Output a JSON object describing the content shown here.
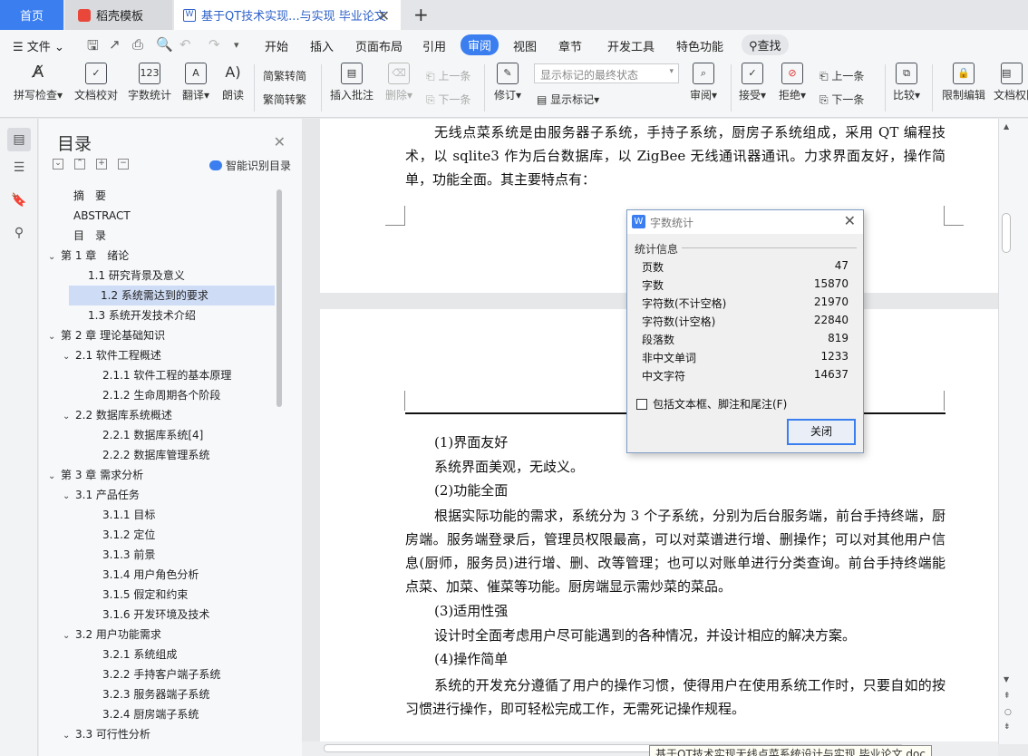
{
  "tabs": {
    "home": "首页",
    "templates": "稻壳模板",
    "document": "基于QT技术实现...与实现 毕业论文"
  },
  "menu": {
    "file": "文件",
    "start": "开始",
    "insert": "插入",
    "layout": "页面布局",
    "reference": "引用",
    "review": "审阅",
    "view": "视图",
    "chapter": "章节",
    "devtools": "开发工具",
    "features": "特色功能",
    "search": "查找"
  },
  "toolbar": {
    "spell": "拼写检查",
    "proofread": "文档校对",
    "wordcount": "字数统计",
    "translate": "翻译",
    "read": "朗读",
    "t2s": "繁转简",
    "s2t": "简转繁",
    "comment": "插入批注",
    "delete": "删除",
    "prev_comment": "上一条",
    "next_comment": "下一条",
    "track": "修订",
    "markstate": "显示标记的最终状态",
    "showmark": "显示标记",
    "reviewpane": "审阅",
    "accept": "接受",
    "reject": "拒绝",
    "prev_change": "上一条",
    "next_change": "下一条",
    "compare": "比较",
    "restrict": "限制编辑",
    "permission": "文档权限"
  },
  "outline": {
    "title": "目录",
    "smart": "智能识别目录",
    "items": [
      {
        "text": "摘　要",
        "level": 0,
        "caret": ""
      },
      {
        "text": "ABSTRACT",
        "level": 0,
        "caret": ""
      },
      {
        "text": "目　录",
        "level": 0,
        "caret": ""
      },
      {
        "text": "第 1 章　绪论",
        "level": 0,
        "caret": "down"
      },
      {
        "text": "1.1 研究背景及意义",
        "level": 1,
        "caret": ""
      },
      {
        "text": "1.2 系统需达到的要求",
        "level": 1,
        "caret": "",
        "selected": true
      },
      {
        "text": "1.3 系统开发技术介绍",
        "level": 1,
        "caret": ""
      },
      {
        "text": "第 2 章  理论基础知识",
        "level": 0,
        "caret": "down"
      },
      {
        "text": "2.1 软件工程概述",
        "level": 1,
        "caret": "down"
      },
      {
        "text": "2.1.1  软件工程的基本原理",
        "level": 2,
        "caret": ""
      },
      {
        "text": "2.1.2  生命周期各个阶段",
        "level": 2,
        "caret": ""
      },
      {
        "text": "2.2  数据库系统概述",
        "level": 1,
        "caret": "down"
      },
      {
        "text": "2.2.1  数据库系统[4]",
        "level": 2,
        "caret": ""
      },
      {
        "text": "2.2.2  数据库管理系统",
        "level": 2,
        "caret": ""
      },
      {
        "text": "第 3 章  需求分析",
        "level": 0,
        "caret": "down"
      },
      {
        "text": "3.1 产品任务",
        "level": 1,
        "caret": "down"
      },
      {
        "text": "3.1.1 目标",
        "level": 2,
        "caret": ""
      },
      {
        "text": "3.1.2 定位",
        "level": 2,
        "caret": ""
      },
      {
        "text": "3.1.3 前景",
        "level": 2,
        "caret": ""
      },
      {
        "text": "3.1.4 用户角色分析",
        "level": 2,
        "caret": ""
      },
      {
        "text": "3.1.5 假定和约束",
        "level": 2,
        "caret": ""
      },
      {
        "text": "3.1.6 开发环境及技术",
        "level": 2,
        "caret": ""
      },
      {
        "text": "3.2 用户功能需求",
        "level": 1,
        "caret": "down"
      },
      {
        "text": "3.2.1 系统组成",
        "level": 2,
        "caret": ""
      },
      {
        "text": "3.2.2 手持客户端子系统",
        "level": 2,
        "caret": ""
      },
      {
        "text": "3.2.3 服务器端子系统",
        "level": 2,
        "caret": ""
      },
      {
        "text": "3.2.4 厨房端子系统",
        "level": 2,
        "caret": ""
      },
      {
        "text": "3.3 可行性分析",
        "level": 1,
        "caret": "down"
      }
    ]
  },
  "doc": {
    "intro": "无线点菜系统是由服务器子系统，手持子系统，厨房子系统组成，采用 QT 编程技术，以 sqlite3 作为后台数据库，以 ZigBee 无线通讯器通讯。力求界面友好，操作简单，功能全面。其主要特点有：",
    "f1h": "(1)界面友好",
    "f1t": "系统界面美观，无歧义。",
    "f2h": "(2)功能全面",
    "f2t": "根据实际功能的需求，系统分为 3 个子系统，分别为后台服务端，前台手持终端，厨房端。服务端登录后，管理员权限最高，可以对菜谱进行增、删操作；可以对其他用户信息(厨师，服务员)进行增、删、改等管理；也可以对账单进行分类查询。前台手持终端能点菜、加菜、催菜等功能。厨房端显示需炒菜的菜品。",
    "f3h": "(3)适用性强",
    "f3t": "设计时全面考虑用户尽可能遇到的各种情况，并设计相应的解决方案。",
    "f4h": "(4)操作简单",
    "f4t": "系统的开发充分遵循了用户的操作习惯，使得用户在使用系统工作时，只要自如的按习惯进行操作，即可轻松完成工作，无需死记操作规程。"
  },
  "dialog": {
    "title": "字数统计",
    "group": "统计信息",
    "stats": [
      {
        "label": "页数",
        "value": "47"
      },
      {
        "label": "字数",
        "value": "15870"
      },
      {
        "label": "字符数(不计空格)",
        "value": "21970"
      },
      {
        "label": "字符数(计空格)",
        "value": "22840"
      },
      {
        "label": "段落数",
        "value": "819"
      },
      {
        "label": "非中文单词",
        "value": "1233"
      },
      {
        "label": "中文字符",
        "value": "14637"
      }
    ],
    "checkbox": "包括文本框、脚注和尾注(F)",
    "close": "关闭"
  },
  "tooltip": "基于QT技术实现无线点菜系统设计与实现 毕业论文.doc",
  "colors": {
    "accent": "#3a7ef0",
    "selected_toc": "#cfdcf5"
  }
}
